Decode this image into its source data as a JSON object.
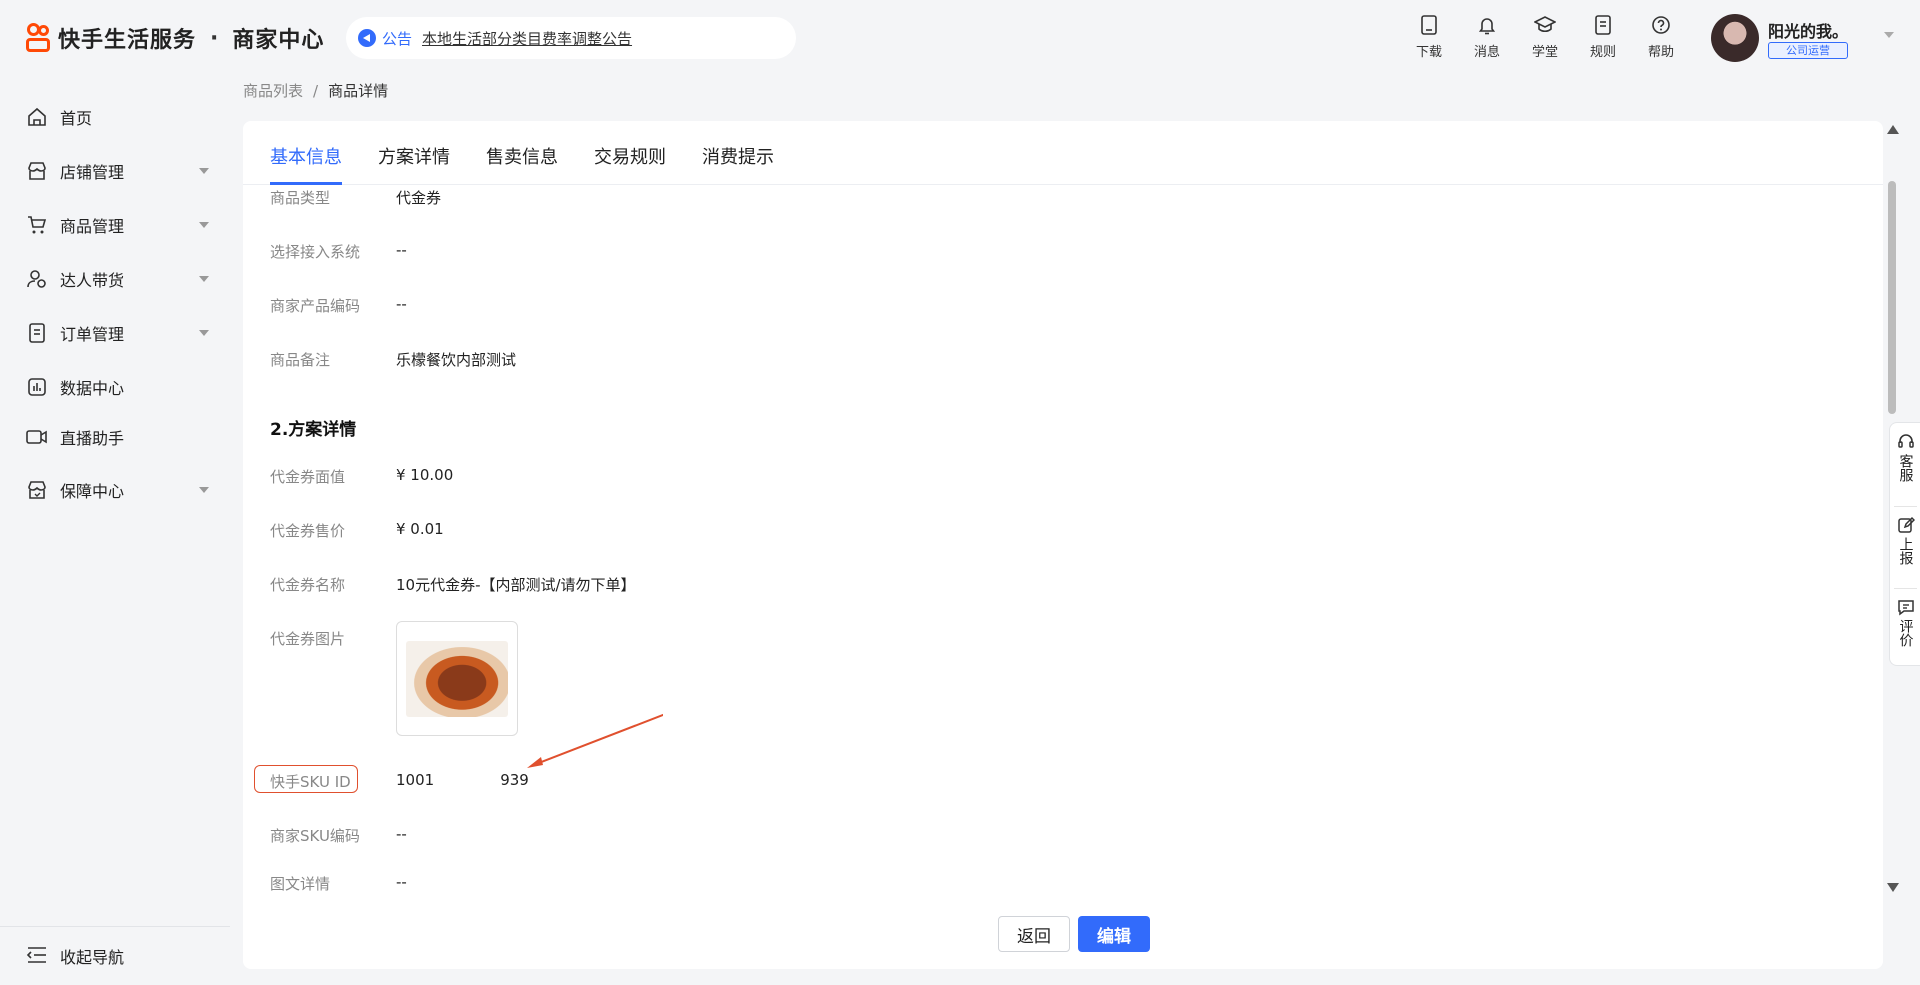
{
  "header": {
    "brand": "快手生活服务",
    "separator": "·",
    "center": "商家中心",
    "notice_label": "公告",
    "notice_text": "本地生活部分类目费率调整公告",
    "tools": [
      {
        "label": "下载",
        "icon": "download-icon"
      },
      {
        "label": "消息",
        "icon": "bell-icon"
      },
      {
        "label": "学堂",
        "icon": "graduation-cap-icon"
      },
      {
        "label": "规则",
        "icon": "rules-doc-icon"
      },
      {
        "label": "帮助",
        "icon": "help-circle-icon"
      }
    ],
    "user_name": "阳光的我。",
    "user_role": "公司运营"
  },
  "sidebar": {
    "items": [
      {
        "label": "首页",
        "icon": "home-icon",
        "has_children": false
      },
      {
        "label": "店铺管理",
        "icon": "store-icon",
        "has_children": true
      },
      {
        "label": "商品管理",
        "icon": "cart-icon",
        "has_children": true
      },
      {
        "label": "达人带货",
        "icon": "influencer-icon",
        "has_children": true
      },
      {
        "label": "订单管理",
        "icon": "order-icon",
        "has_children": true
      },
      {
        "label": "数据中心",
        "icon": "chart-icon",
        "has_children": false
      },
      {
        "label": "直播助手",
        "icon": "video-icon",
        "has_children": false
      },
      {
        "label": "保障中心",
        "icon": "shield-icon",
        "has_children": true
      }
    ],
    "collapse_label": "收起导航"
  },
  "breadcrumb": {
    "parent": "商品列表",
    "separator": "/",
    "current": "商品详情"
  },
  "tabs": [
    "基本信息",
    "方案详情",
    "售卖信息",
    "交易规则",
    "消费提示"
  ],
  "active_tab": "基本信息",
  "basic_info": [
    {
      "label": "商品类型",
      "value": "代金券"
    },
    {
      "label": "选择接入系统",
      "value": "--"
    },
    {
      "label": "商家产品编码",
      "value": "--"
    },
    {
      "label": "商品备注",
      "value": "乐檬餐饮内部测试"
    }
  ],
  "plan_section_title": "2.方案详情",
  "plan_details": [
    {
      "label": "代金券面值",
      "value": "¥ 10.00"
    },
    {
      "label": "代金券售价",
      "value": "¥ 0.01"
    },
    {
      "label": "代金券名称",
      "value": "10元代金券-【内部测试/请勿下单】"
    },
    {
      "label": "代金券图片",
      "value": ""
    }
  ],
  "sku": {
    "label": "快手SKU ID",
    "value_prefix": "1001",
    "value_suffix": "939"
  },
  "extra_rows": [
    {
      "label": "商家SKU编码",
      "value": "--"
    },
    {
      "label": "图文详情",
      "value": "--"
    }
  ],
  "buttons": {
    "back": "返回",
    "edit": "编辑"
  },
  "float_panel": [
    {
      "label": "客服",
      "icon": "headset-icon"
    },
    {
      "label": "上报",
      "icon": "edit-report-icon"
    },
    {
      "label": "评价",
      "icon": "comment-icon"
    }
  ],
  "colors": {
    "primary": "#326bfb",
    "brand": "#ff4906",
    "highlight": "#e0502e"
  }
}
